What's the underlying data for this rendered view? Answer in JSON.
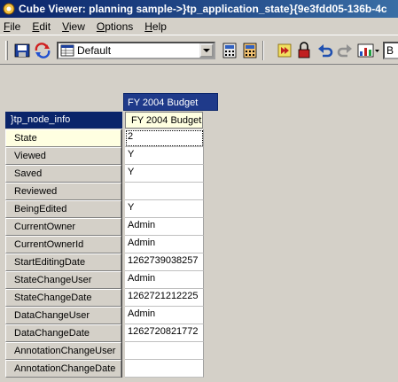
{
  "window": {
    "title": "Cube Viewer: planning sample->}tp_application_state}{9e3fdd05-136b-4c"
  },
  "menu": [
    {
      "u": "F",
      "rest": "ile"
    },
    {
      "u": "E",
      "rest": "dit"
    },
    {
      "u": "V",
      "rest": "iew"
    },
    {
      "u": "O",
      "rest": "ptions"
    },
    {
      "u": "H",
      "rest": "elp"
    }
  ],
  "toolbar": {
    "view_name": "Default",
    "right_combo_text": "B",
    "icons": [
      "save-icon",
      "recalculate-icon",
      "view-icon",
      "calculator-icon",
      "calculator-alt-icon",
      "export-icon",
      "lock-icon",
      "undo-icon",
      "redo-icon",
      "chart-icon"
    ]
  },
  "grid": {
    "column_dimension_title": "FY 2004 Budget",
    "row_dimension_title": "}tp_node_info",
    "column_element": "FY 2004 Budget",
    "rows": [
      {
        "label": "State",
        "value": "2",
        "selected": true
      },
      {
        "label": "Viewed",
        "value": "Y"
      },
      {
        "label": "Saved",
        "value": "Y"
      },
      {
        "label": "Reviewed",
        "value": ""
      },
      {
        "label": "BeingEdited",
        "value": "Y"
      },
      {
        "label": "CurrentOwner",
        "value": "Admin"
      },
      {
        "label": "CurrentOwnerId",
        "value": "Admin"
      },
      {
        "label": "StartEditingDate",
        "value": "1262739038257"
      },
      {
        "label": "StateChangeUser",
        "value": "Admin"
      },
      {
        "label": "StateChangeDate",
        "value": "1262721212225"
      },
      {
        "label": "DataChangeUser",
        "value": "Admin"
      },
      {
        "label": "DataChangeDate",
        "value": "1262720821772"
      },
      {
        "label": "AnnotationChangeUser",
        "value": ""
      },
      {
        "label": "AnnotationChangeDate",
        "value": ""
      }
    ]
  }
}
